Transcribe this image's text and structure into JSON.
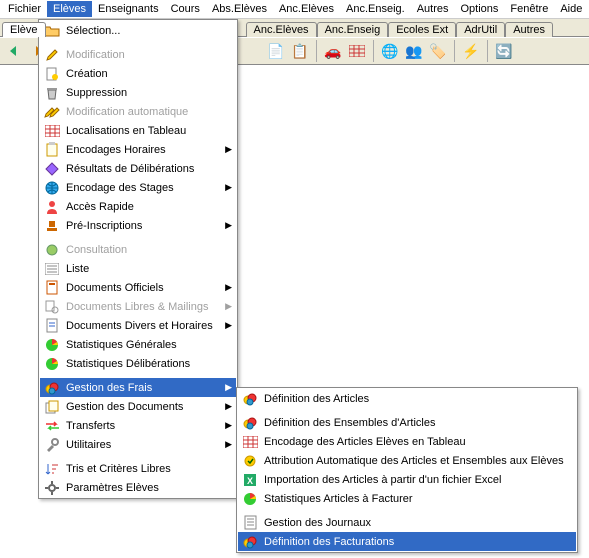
{
  "menubar": {
    "items": [
      "Fichier",
      "Elèves",
      "Enseignants",
      "Cours",
      "Abs.Elèves",
      "Anc.Elèves",
      "Anc.Enseig.",
      "Autres",
      "Options",
      "Fenêtre",
      "Aide"
    ],
    "active_index": 1
  },
  "tabs": {
    "items": [
      "Elève",
      "",
      "",
      "Anc.Elèves",
      "Anc.Enseig",
      "Ecoles Ext",
      "AdrUtil",
      "Autres"
    ],
    "visible_from": 0
  },
  "toolbar": {
    "icons": [
      "back-icon",
      "forward-icon",
      "sep",
      "doc-icon",
      "copy-icon",
      "sep",
      "car-icon",
      "grid-icon",
      "sep",
      "globe-icon",
      "people-icon",
      "badge-icon",
      "sep",
      "lightning-icon",
      "sep",
      "refresh-icon"
    ]
  },
  "menu_eleves": {
    "items": [
      {
        "icon": "folder-open",
        "label": "Sélection...",
        "submenu": false
      },
      {
        "sep": true
      },
      {
        "icon": "pencil",
        "label": "Modification",
        "disabled": true
      },
      {
        "icon": "new-doc",
        "label": "Création"
      },
      {
        "icon": "trash",
        "label": "Suppression"
      },
      {
        "icon": "double-pencil",
        "label": "Modification automatique",
        "disabled": true
      },
      {
        "icon": "grid-red",
        "label": "Localisations en Tableau"
      },
      {
        "icon": "clipboard",
        "label": "Encodages Horaires",
        "submenu": true
      },
      {
        "icon": "diamond",
        "label": "Résultats de Délibérations"
      },
      {
        "icon": "globe",
        "label": "Encodage des Stages",
        "submenu": true
      },
      {
        "icon": "person-red",
        "label": "Accès Rapide"
      },
      {
        "icon": "stamp",
        "label": "Pré-Inscriptions",
        "submenu": true
      },
      {
        "sep": true
      },
      {
        "icon": "circle",
        "label": "Consultation",
        "disabled": true
      },
      {
        "icon": "list",
        "label": "Liste"
      },
      {
        "icon": "doc-official",
        "label": "Documents Officiels",
        "submenu": true
      },
      {
        "icon": "doc-chain",
        "label": "Documents Libres  & Mailings",
        "submenu": true,
        "disabled": true
      },
      {
        "icon": "doc-misc",
        "label": "Documents Divers et Horaires",
        "submenu": true
      },
      {
        "icon": "pie",
        "label": "Statistiques Générales"
      },
      {
        "icon": "pie",
        "label": "Statistiques Délibérations"
      },
      {
        "sep": true
      },
      {
        "icon": "money",
        "label": "Gestion des Frais",
        "submenu": true,
        "highlight": true
      },
      {
        "icon": "docs-stack",
        "label": "Gestion des Documents",
        "submenu": true
      },
      {
        "icon": "transfer",
        "label": "Transferts",
        "submenu": true
      },
      {
        "icon": "tools",
        "label": "Utilitaires",
        "submenu": true
      },
      {
        "sep": true
      },
      {
        "icon": "sort",
        "label": "Tris et Critères Libres"
      },
      {
        "icon": "gear",
        "label": "Paramètres Elèves"
      }
    ]
  },
  "menu_sub": {
    "items": [
      {
        "icon": "money",
        "label": "Définition des Articles"
      },
      {
        "sep": true
      },
      {
        "icon": "money",
        "label": "Définition des Ensembles d'Articles"
      },
      {
        "icon": "grid-red",
        "label": "Encodage des Articles Elèves en Tableau"
      },
      {
        "icon": "auto",
        "label": "Attribution Automatique des Articles et Ensembles aux Elèves"
      },
      {
        "icon": "excel",
        "label": "Importation des Articles à partir d'un fichier Excel"
      },
      {
        "icon": "pie",
        "label": "Statistiques Articles à Facturer"
      },
      {
        "sep": true
      },
      {
        "icon": "journal",
        "label": "Gestion des Journaux"
      },
      {
        "icon": "money",
        "label": "Définition des Facturations",
        "highlight": true
      }
    ]
  }
}
